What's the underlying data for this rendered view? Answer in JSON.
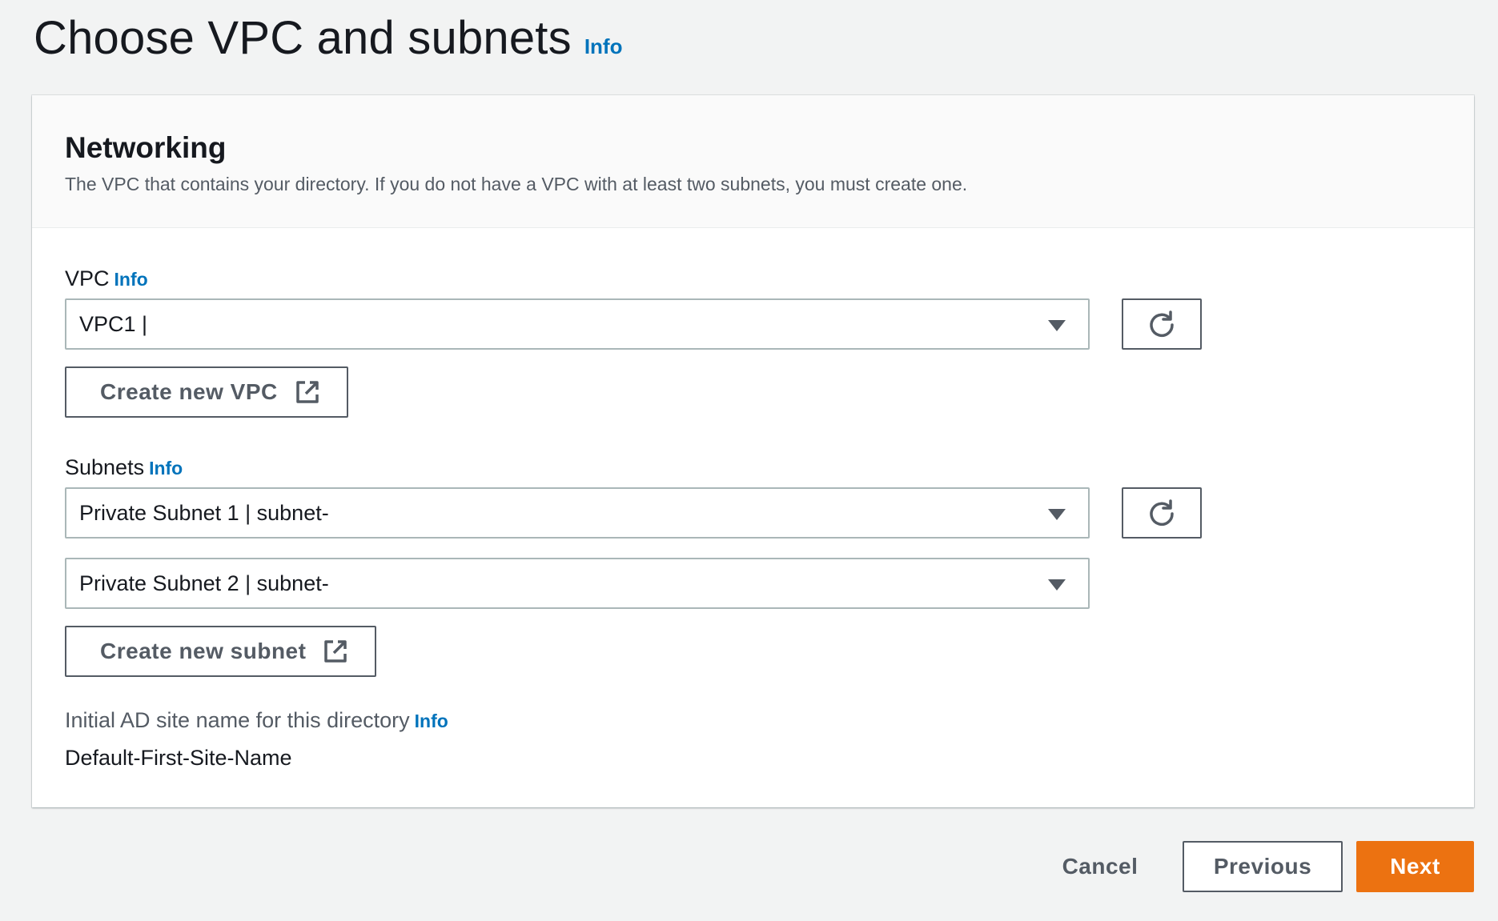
{
  "page": {
    "title": "Choose VPC and subnets",
    "info_label": "Info"
  },
  "networking": {
    "title": "Networking",
    "description": "The VPC that contains your directory. If you do not have a VPC with at least two subnets, you must create one."
  },
  "vpc": {
    "label": "VPC",
    "info_label": "Info",
    "selected": "VPC1 |",
    "create_label": "Create new VPC"
  },
  "subnets": {
    "label": "Subnets",
    "info_label": "Info",
    "selected_1": "Private Subnet 1 | subnet-",
    "selected_2": "Private Subnet 2 | subnet-",
    "create_label": "Create new subnet"
  },
  "ad_site": {
    "label": "Initial AD site name for this directory",
    "info_label": "Info",
    "value": "Default-First-Site-Name"
  },
  "footer": {
    "cancel_label": "Cancel",
    "previous_label": "Previous",
    "next_label": "Next"
  },
  "colors": {
    "link": "#0073bb",
    "primary": "#ec7211",
    "border": "#545b64",
    "background": "#f2f3f3"
  },
  "icons": {
    "refresh": "refresh-icon",
    "external": "external-link-icon",
    "caret": "caret-down-icon"
  }
}
